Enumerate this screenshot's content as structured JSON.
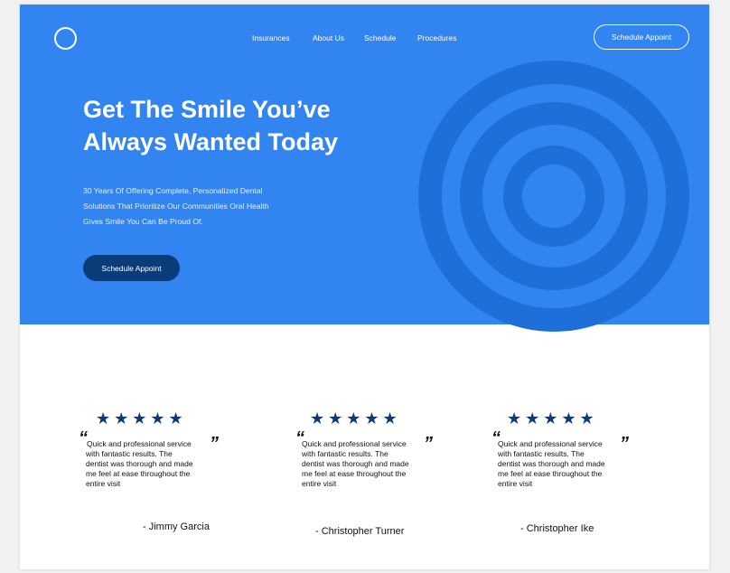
{
  "nav": {
    "items": [
      "Insurances",
      "About Us",
      "Schedule",
      "Procedures"
    ],
    "cta_label": "Schedule Appoint"
  },
  "hero": {
    "headline_line1": "Get The Smile You’ve",
    "headline_line2": "Always Wanted Today",
    "subtitle_line1": "30 Years Of Offering Complete, Personalized Dental",
    "subtitle_line2": "Solutions That Prioritize Our Communities Oral Health",
    "subtitle_line3": "Gives Smile You Can Be Proud Of.",
    "cta_label": "Schedule Appoint"
  },
  "testimonials": [
    {
      "stars": "★★★★★",
      "rating": 5,
      "open_quote": "“",
      "close_quote": "”",
      "text_line1": "Quick and professional service",
      "text_line2": "with fantastic results. The",
      "text_line3": "dentist was thorough and made",
      "text_line4": "me feel at ease throughout the",
      "text_line5": "entire visit",
      "author": "- Jimmy Garcia"
    },
    {
      "stars": "★★★★★",
      "rating": 5,
      "open_quote": "“",
      "close_quote": "”",
      "text_line1": "Quick and professional service",
      "text_line2": "with fantastic results. The",
      "text_line3": "dentist was thorough and made",
      "text_line4": "me feel at ease throughout the",
      "text_line5": "entire visit",
      "author": "- Christopher Turner"
    },
    {
      "stars": "★★★★★",
      "rating": 5,
      "open_quote": "“",
      "close_quote": "”",
      "text_line1": "Quick and professional service",
      "text_line2": "with fantastic results. The",
      "text_line3": "dentist was thorough and made",
      "text_line4": "me feel at ease throughout the",
      "text_line5": "entire visit",
      "author": "- Christopher Ike"
    }
  ],
  "colors": {
    "hero_bg": "#3285f0",
    "ring_dark": "#1f6fd8",
    "dark_button": "#0b3c7a",
    "star": "#0b3c7a"
  },
  "icons": {
    "logo": "circle-logo-icon",
    "hero_graphic": "concentric-circles-icon",
    "rating": "star-icon"
  }
}
